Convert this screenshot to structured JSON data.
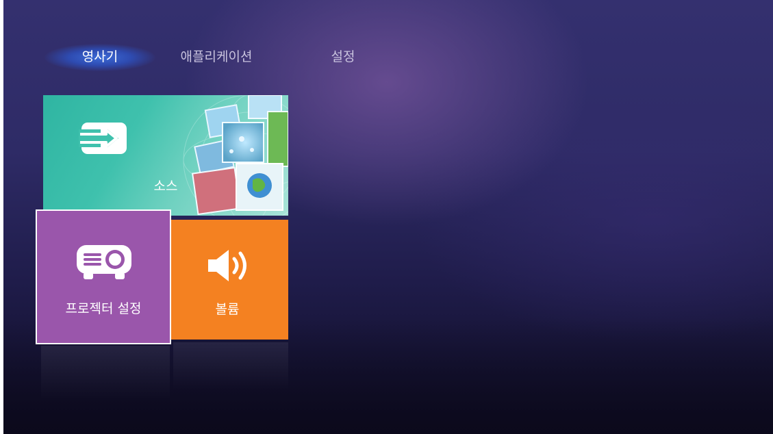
{
  "tabs": [
    {
      "label": "영사기",
      "active": true
    },
    {
      "label": "애플리케이션",
      "active": false
    },
    {
      "label": "설정",
      "active": false
    }
  ],
  "tiles": {
    "source": {
      "label": "소스",
      "icon": "source-input-icon",
      "color": "#3fc1ad"
    },
    "projector_settings": {
      "label": "프로젝터 설정",
      "icon": "projector-icon",
      "color": "#9a56ab",
      "selected": true
    },
    "volume": {
      "label": "볼륨",
      "icon": "speaker-volume-icon",
      "color": "#f48121"
    }
  },
  "colors": {
    "background": "#2e2b66",
    "tab_highlight": "#3c6edc",
    "active_tab_text": "#ffffff",
    "inactive_tab_text": "#c9c3de"
  }
}
